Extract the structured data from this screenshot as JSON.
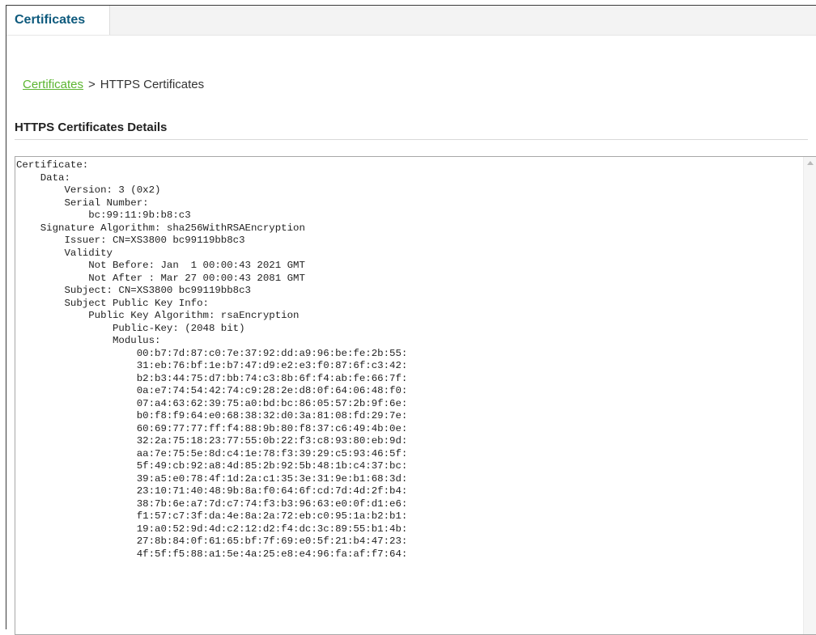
{
  "tab": {
    "label": "Certificates"
  },
  "breadcrumb": {
    "link": "Certificates",
    "separator": ">",
    "current": "HTTPS Certificates"
  },
  "section": {
    "title": "HTTPS Certificates Details"
  },
  "certificate": {
    "lines": [
      "Certificate:",
      "    Data:",
      "        Version: 3 (0x2)",
      "        Serial Number:",
      "            bc:99:11:9b:b8:c3",
      "    Signature Algorithm: sha256WithRSAEncryption",
      "        Issuer: CN=XS3800 bc99119bb8c3",
      "        Validity",
      "            Not Before: Jan  1 00:00:43 2021 GMT",
      "            Not After : Mar 27 00:00:43 2081 GMT",
      "        Subject: CN=XS3800 bc99119bb8c3",
      "        Subject Public Key Info:",
      "            Public Key Algorithm: rsaEncryption",
      "                Public-Key: (2048 bit)",
      "                Modulus:",
      "                    00:b7:7d:87:c0:7e:37:92:dd:a9:96:be:fe:2b:55:",
      "                    31:eb:76:bf:1e:b7:47:d9:e2:e3:f0:87:6f:c3:42:",
      "                    b2:b3:44:75:d7:bb:74:c3:8b:6f:f4:ab:fe:66:7f:",
      "                    0a:e7:74:54:42:74:c9:28:2e:d8:0f:64:06:48:f0:",
      "                    07:a4:63:62:39:75:a0:bd:bc:86:05:57:2b:9f:6e:",
      "                    b0:f8:f9:64:e0:68:38:32:d0:3a:81:08:fd:29:7e:",
      "                    60:69:77:77:ff:f4:88:9b:80:f8:37:c6:49:4b:0e:",
      "                    32:2a:75:18:23:77:55:0b:22:f3:c8:93:80:eb:9d:",
      "                    aa:7e:75:5e:8d:c4:1e:78:f3:39:29:c5:93:46:5f:",
      "                    5f:49:cb:92:a8:4d:85:2b:92:5b:48:1b:c4:37:bc:",
      "                    39:a5:e0:78:4f:1d:2a:c1:35:3e:31:9e:b1:68:3d:",
      "                    23:10:71:40:48:9b:8a:f0:64:6f:cd:7d:4d:2f:b4:",
      "                    38:7b:6e:a7:7d:c7:74:f3:b3:96:63:e0:0f:d1:e6:",
      "                    f1:57:c7:3f:da:4e:8a:2a:72:eb:c0:95:1a:b2:b1:",
      "                    19:a0:52:9d:4d:c2:12:d2:f4:dc:3c:89:55:b1:4b:",
      "                    27:8b:84:0f:61:65:bf:7f:69:e0:5f:21:b4:47:23:",
      "                    4f:5f:f5:88:a1:5e:4a:25:e8:e4:96:fa:af:f7:64:"
    ]
  },
  "colors": {
    "tab_text": "#0e5a7d",
    "link": "#5cb531"
  },
  "icons": {
    "scroll_up": "scroll-up-arrow-icon"
  }
}
